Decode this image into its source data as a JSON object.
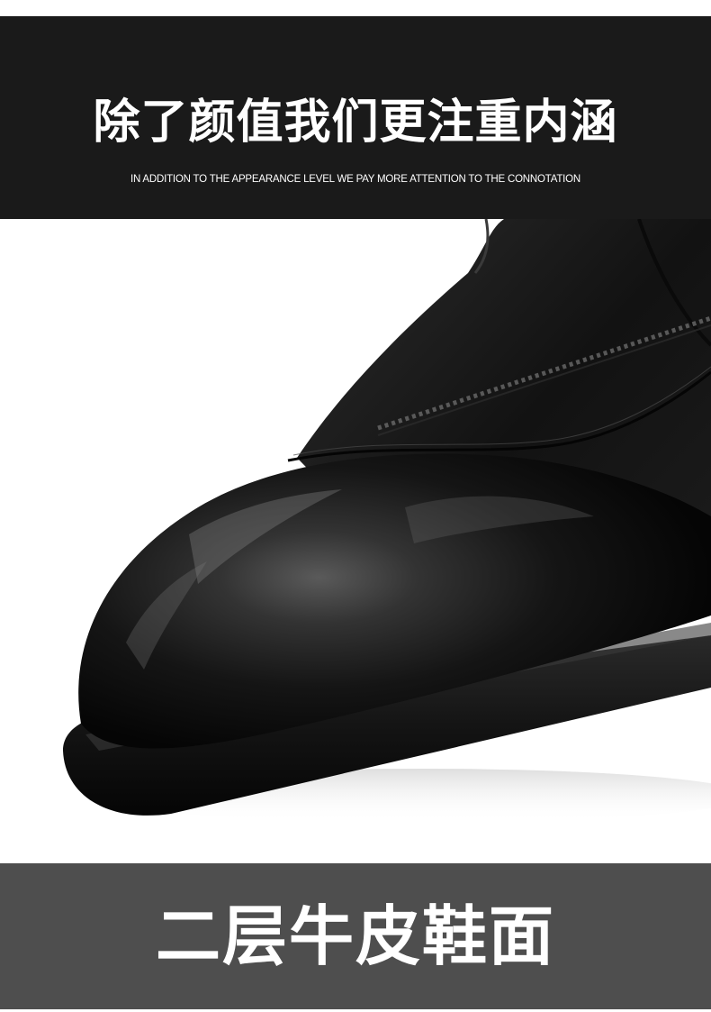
{
  "header": {
    "title": "除了颜值我们更注重内涵",
    "subtitle": "IN ADDITION TO THE APPEARANCE LEVEL WE PAY MORE ATTENTION TO THE CONNOTATION"
  },
  "footer": {
    "title": "二层牛皮鞋面"
  },
  "colors": {
    "top_banner": "#1a1a1a",
    "bottom_banner": "#4e4e4e",
    "text": "#ffffff",
    "photo_background": "#ffffff"
  }
}
